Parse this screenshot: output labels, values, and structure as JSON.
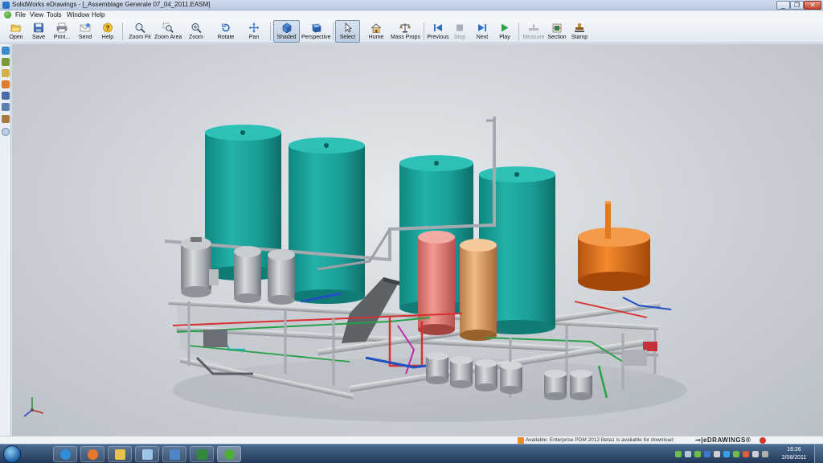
{
  "window": {
    "title": "SolidWorks eDrawings - [_Assemblage Generale 07_04_2011.EASM]",
    "controls": [
      "_",
      "❐",
      "✕"
    ]
  },
  "menu": [
    "File",
    "View",
    "Tools",
    "Window",
    "Help"
  ],
  "toolbar": [
    {
      "label": "Open",
      "icon": "open-folder-icon"
    },
    {
      "label": "Save",
      "icon": "save-icon"
    },
    {
      "label": "Print...",
      "icon": "print-icon"
    },
    {
      "label": "Send",
      "icon": "send-icon"
    },
    {
      "label": "Help",
      "icon": "help-icon"
    },
    {
      "label": "Zoom Fit",
      "icon": "zoom-fit-icon"
    },
    {
      "label": "Zoom Area",
      "icon": "zoom-area-icon"
    },
    {
      "label": "Zoom",
      "icon": "zoom-icon"
    },
    {
      "label": "Rotate",
      "icon": "rotate-icon"
    },
    {
      "label": "Pan",
      "icon": "pan-icon"
    },
    {
      "label": "Shaded",
      "icon": "shaded-cube-icon",
      "active": true
    },
    {
      "label": "Perspective",
      "icon": "perspective-icon"
    },
    {
      "label": "Select",
      "icon": "select-cursor-icon",
      "active": true
    },
    {
      "label": "Home",
      "icon": "home-icon"
    },
    {
      "label": "Mass Props",
      "icon": "mass-props-icon"
    },
    {
      "label": "Previous",
      "icon": "previous-icon"
    },
    {
      "label": "Stop",
      "icon": "stop-icon",
      "disabled": true
    },
    {
      "label": "Next",
      "icon": "next-icon"
    },
    {
      "label": "Play",
      "icon": "play-icon"
    },
    {
      "label": "Measure",
      "icon": "measure-icon",
      "disabled": true
    },
    {
      "label": "Section",
      "icon": "section-icon"
    },
    {
      "label": "Stamp",
      "icon": "stamp-icon"
    }
  ],
  "side_panel_icons": [
    "components-icon",
    "configurations-icon",
    "sheets-icon",
    "markup-icon",
    "callout-icon",
    "layers-icon",
    "stamp-panel-icon",
    "expand-icon"
  ],
  "status": {
    "message": "Available: Enterprise PDM 2012 Beta1 is available for download",
    "brand": "⊸|eDRAWINGS®"
  },
  "taskbar": {
    "apps": [
      "internet-explorer",
      "media-player",
      "folder",
      "windows-explorer",
      "app-grid",
      "excel",
      "edrawings"
    ],
    "time": "16:26",
    "date": "2/08/2011"
  },
  "colors": {
    "tank_teal": "#1aa29a",
    "tank_pink": "#e0807a",
    "tank_tan": "#d9a06a",
    "tank_orange": "#e0731e",
    "steel": "#a9adb3"
  }
}
